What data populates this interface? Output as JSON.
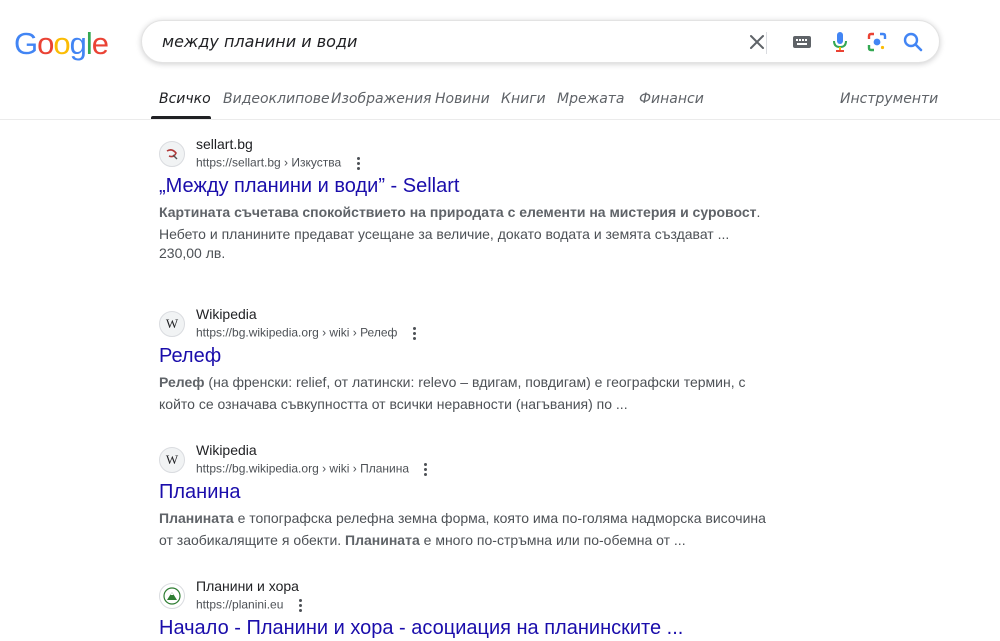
{
  "logo": {
    "text": "Google"
  },
  "search": {
    "query": "между планини и води"
  },
  "tabs": [
    {
      "label": "Всичко",
      "active": true
    },
    {
      "label": "Видеоклипове"
    },
    {
      "label": "Изображения"
    },
    {
      "label": "Новини"
    },
    {
      "label": "Книги"
    },
    {
      "label": "Мрежата"
    },
    {
      "label": "Финанси"
    }
  ],
  "tools_label": "Инструменти",
  "results": [
    {
      "site": "sellart.bg",
      "url": "https://sellart.bg › Изкуства",
      "title": "„Между планини и води” - Sellart",
      "snippet_bold": "Картината съчетава спокойствието на природата с елементи на мистерия и суровост",
      "snippet_rest": ". Небето и планините предават усещане за величие, докато водата и земята създават ...",
      "price": "230,00 лв."
    },
    {
      "site": "Wikipedia",
      "url": "https://bg.wikipedia.org › wiki › Релеф",
      "title": "Релеф",
      "snippet_bold": "Релеф",
      "snippet_rest": " (на френски: relief, от латински: relevo – вдигам, повдигам) е географски термин, с който се означава съвкупността от всички неравности (нагъвания) по ..."
    },
    {
      "site": "Wikipedia",
      "url": "https://bg.wikipedia.org › wiki › Планина",
      "title": "Планина",
      "snippet_bold": "Планината",
      "snippet_mid": " е топографска релефна земна форма, която има по-голяма надморска височина от заобикалящите я обекти. ",
      "snippet_bold2": "Планината",
      "snippet_rest": " е много по-стръмна или по-обемна от ..."
    },
    {
      "site": "Планини и хора",
      "url": "https://planini.eu",
      "title": "Начало - Планини и хора - асоциация на планинските ..."
    }
  ],
  "colors": {
    "link": "#1a0dab",
    "logo_blue": "#4285f4",
    "logo_red": "#ea4335",
    "logo_yellow": "#fbbc05",
    "logo_green": "#34a853"
  },
  "icons": [
    "clear-icon",
    "keyboard-icon",
    "microphone-icon",
    "google-lens-icon",
    "search-icon",
    "more-options-icon"
  ]
}
